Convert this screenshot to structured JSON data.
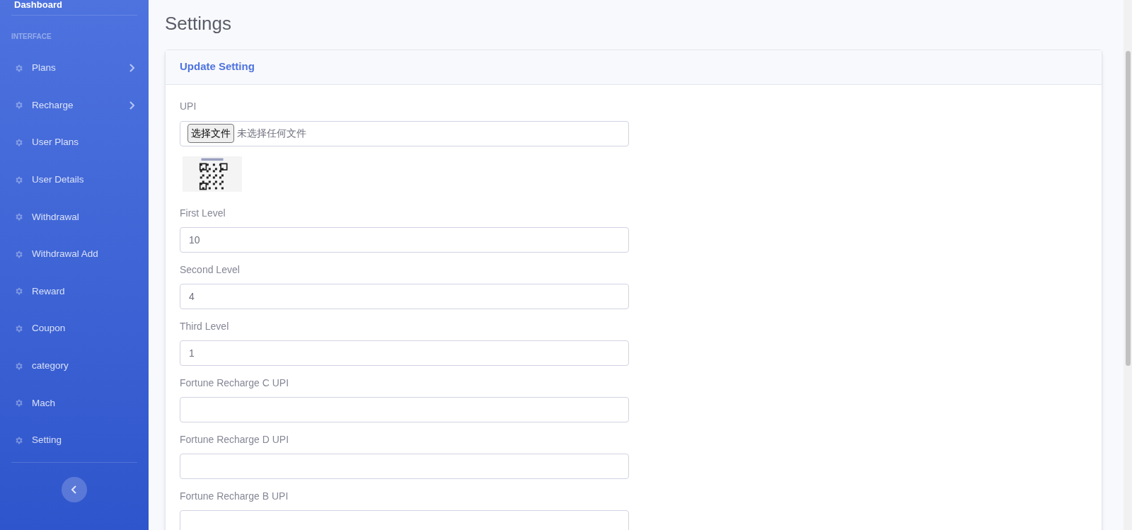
{
  "sidebar": {
    "top_item": "Dashboard",
    "section_heading": "INTERFACE",
    "items": [
      {
        "label": "Plans",
        "has_submenu": true
      },
      {
        "label": "Recharge",
        "has_submenu": true
      },
      {
        "label": "User Plans",
        "has_submenu": false
      },
      {
        "label": "User Details",
        "has_submenu": false
      },
      {
        "label": "Withdrawal",
        "has_submenu": false
      },
      {
        "label": "Withdrawal Add",
        "has_submenu": false
      },
      {
        "label": "Reward",
        "has_submenu": false
      },
      {
        "label": "Coupon",
        "has_submenu": false
      },
      {
        "label": "category",
        "has_submenu": false
      },
      {
        "label": "Mach",
        "has_submenu": false
      },
      {
        "label": "Setting",
        "has_submenu": false
      }
    ]
  },
  "page_title": "Settings",
  "card": {
    "title": "Update Setting",
    "fields": [
      {
        "kind": "file",
        "label": "UPI",
        "button": "选择文件",
        "status": "未选择任何文件",
        "has_preview": true
      },
      {
        "kind": "text",
        "label": "First Level",
        "value": "10"
      },
      {
        "kind": "text",
        "label": "Second Level",
        "value": "4"
      },
      {
        "kind": "text",
        "label": "Third Level",
        "value": "1"
      },
      {
        "kind": "text",
        "label": "Fortune Recharge C UPI"
      },
      {
        "kind": "text",
        "label": "Fortune Recharge D UPI"
      },
      {
        "kind": "text",
        "label": "Fortune Recharge B UPI"
      }
    ]
  }
}
